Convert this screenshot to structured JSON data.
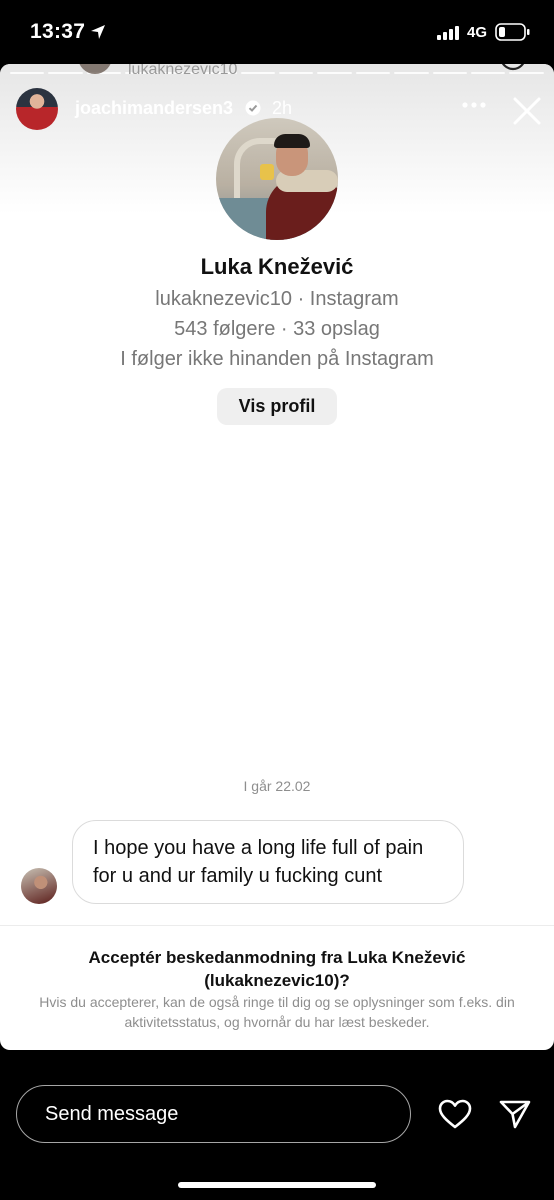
{
  "status_bar": {
    "time": "13:37",
    "network": "4G",
    "icons": [
      "location-arrow-icon",
      "signal-bars-icon",
      "battery-icon"
    ]
  },
  "background_story": {
    "username": "lukaknezevic10"
  },
  "story_header": {
    "username": "joachimandersen3",
    "verified": true,
    "time_ago": "2h",
    "icons": [
      "verified-badge-icon",
      "more-options-icon",
      "close-icon"
    ]
  },
  "profile": {
    "name": "Luka Knežević",
    "handle_line": "lukaknezevic10 · Instagram",
    "stats_line": "543 følgere · 33 opslag",
    "relation_line": "I følger ikke hinanden på Instagram",
    "view_profile_label": "Vis profil"
  },
  "conversation": {
    "date_label": "I går 22.02",
    "message_text": "I hope you have a long life full of pain for u and ur family u fucking cunt"
  },
  "request": {
    "title": "Acceptér beskedanmodning fra Luka Knežević (lukaknezevic10)?",
    "info": "Hvis du accepterer, kan de også ringe til dig og se oplysninger som f.eks. din aktivitetsstatus, og hvornår du har læst beskeder."
  },
  "reply_bar": {
    "placeholder": "Send message",
    "icons": [
      "heart-icon",
      "send-icon"
    ]
  },
  "colors": {
    "background": "#000000",
    "card": "#ffffff",
    "secondary_text": "#8e8e8e",
    "verified": "#3897f0"
  }
}
